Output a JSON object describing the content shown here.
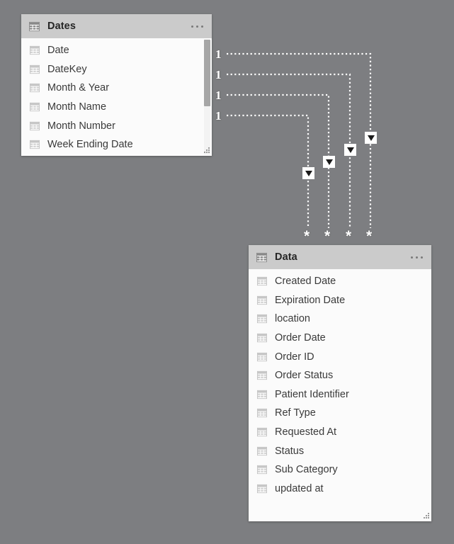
{
  "view": {
    "name": "power-bi-model-view",
    "background_color": "#7d7e81"
  },
  "tables": [
    {
      "id": "dates",
      "title": "Dates",
      "icon": "table-icon",
      "menu_icon": "ellipsis-icon",
      "has_scrollbar": true,
      "fields": [
        {
          "name": "Date",
          "icon": "column-icon"
        },
        {
          "name": "DateKey",
          "icon": "column-icon"
        },
        {
          "name": "Month & Year",
          "icon": "column-icon"
        },
        {
          "name": "Month Name",
          "icon": "column-icon"
        },
        {
          "name": "Month Number",
          "icon": "column-icon"
        },
        {
          "name": "Week Ending Date",
          "icon": "column-icon"
        }
      ]
    },
    {
      "id": "data",
      "title": "Data",
      "icon": "table-icon",
      "menu_icon": "ellipsis-icon",
      "has_scrollbar": false,
      "fields": [
        {
          "name": "Created Date",
          "icon": "column-icon"
        },
        {
          "name": "Expiration Date",
          "icon": "column-icon"
        },
        {
          "name": "location",
          "icon": "column-icon"
        },
        {
          "name": "Order Date",
          "icon": "column-icon"
        },
        {
          "name": "Order ID",
          "icon": "column-icon"
        },
        {
          "name": "Order Status",
          "icon": "column-icon"
        },
        {
          "name": "Patient Identifier",
          "icon": "column-icon"
        },
        {
          "name": "Ref Type",
          "icon": "column-icon"
        },
        {
          "name": "Requested At",
          "icon": "column-icon"
        },
        {
          "name": "Status",
          "icon": "column-icon"
        },
        {
          "name": "Sub Category",
          "icon": "column-icon"
        },
        {
          "name": "updated at",
          "icon": "column-icon"
        }
      ]
    }
  ],
  "relationships": [
    {
      "id": "rel-1",
      "from_table": "Dates",
      "to_table": "Data",
      "from_cardinality": "1",
      "to_cardinality": "*",
      "cross_filter_icon": "filter-direction-down-arrow-icon",
      "line_style": "dotted"
    },
    {
      "id": "rel-2",
      "from_table": "Dates",
      "to_table": "Data",
      "from_cardinality": "1",
      "to_cardinality": "*",
      "cross_filter_icon": "filter-direction-down-arrow-icon",
      "line_style": "dotted"
    },
    {
      "id": "rel-3",
      "from_table": "Dates",
      "to_table": "Data",
      "from_cardinality": "1",
      "to_cardinality": "*",
      "cross_filter_icon": "filter-direction-down-arrow-icon",
      "line_style": "dotted"
    },
    {
      "id": "rel-4",
      "from_table": "Dates",
      "to_table": "Data",
      "from_cardinality": "1",
      "to_cardinality": "*",
      "cross_filter_icon": "filter-direction-down-arrow-icon",
      "line_style": "dotted"
    }
  ]
}
